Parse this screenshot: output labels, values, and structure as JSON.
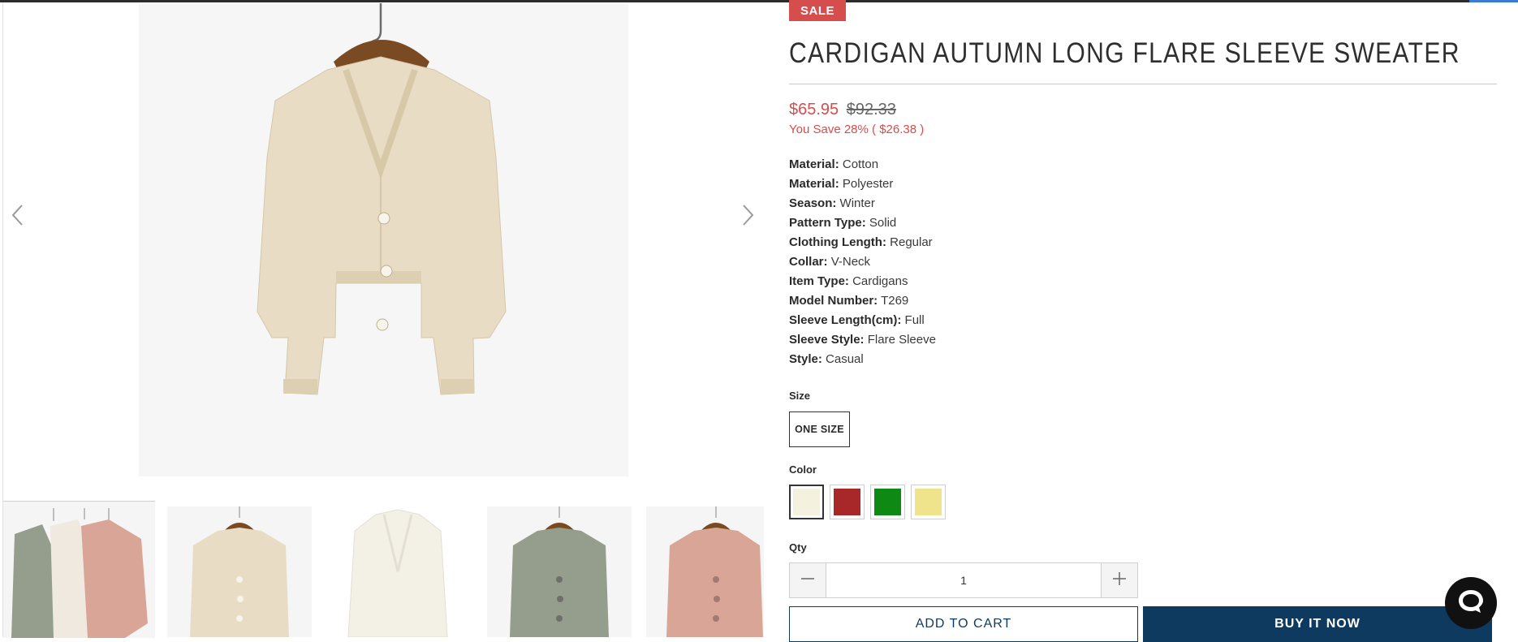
{
  "product": {
    "badge": "SALE",
    "title": "CARDIGAN AUTUMN LONG FLARE SLEEVE SWEATER",
    "price_current": "$65.95",
    "price_compare": "$92.33",
    "savings": "You Save 28% ( $26.38 )",
    "specs": [
      {
        "label": "Material:",
        "value": "Cotton"
      },
      {
        "label": "Material:",
        "value": "Polyester"
      },
      {
        "label": "Season:",
        "value": "Winter"
      },
      {
        "label": "Pattern Type:",
        "value": "Solid"
      },
      {
        "label": "Clothing Length:",
        "value": "Regular"
      },
      {
        "label": "Collar:",
        "value": "V-Neck"
      },
      {
        "label": "Item Type:",
        "value": "Cardigans"
      },
      {
        "label": "Model Number:",
        "value": "T269"
      },
      {
        "label": "Sleeve Length(cm):",
        "value": "Full"
      },
      {
        "label": "Sleeve Style:",
        "value": "Flare Sleeve"
      },
      {
        "label": "Style:",
        "value": "Casual"
      }
    ]
  },
  "options": {
    "size_label": "Size",
    "size_value": "ONE SIZE",
    "color_label": "Color",
    "colors": [
      {
        "hex": "#f4f2df",
        "selected": true
      },
      {
        "hex": "#a8282a",
        "selected": false
      },
      {
        "hex": "#0e8a14",
        "selected": false
      },
      {
        "hex": "#efe48c",
        "selected": false
      }
    ]
  },
  "quantity": {
    "label": "Qty",
    "value": "1"
  },
  "actions": {
    "add_to_cart": "ADD TO CART",
    "buy_now": "BUY IT NOW"
  },
  "gallery": {
    "main_color": "#e8dcc4",
    "thumb_colors": [
      "#e8dcc4",
      "#f3f0e6",
      "#959d8c",
      "#d9a597"
    ],
    "group_colors": [
      "#959d8c",
      "#efe9df",
      "#d9a597"
    ]
  },
  "icons": {
    "prev": "chevron-left-icon",
    "next": "chevron-right-icon",
    "minus": "minus-icon",
    "plus": "plus-icon",
    "chat": "chat-bubble-icon"
  }
}
